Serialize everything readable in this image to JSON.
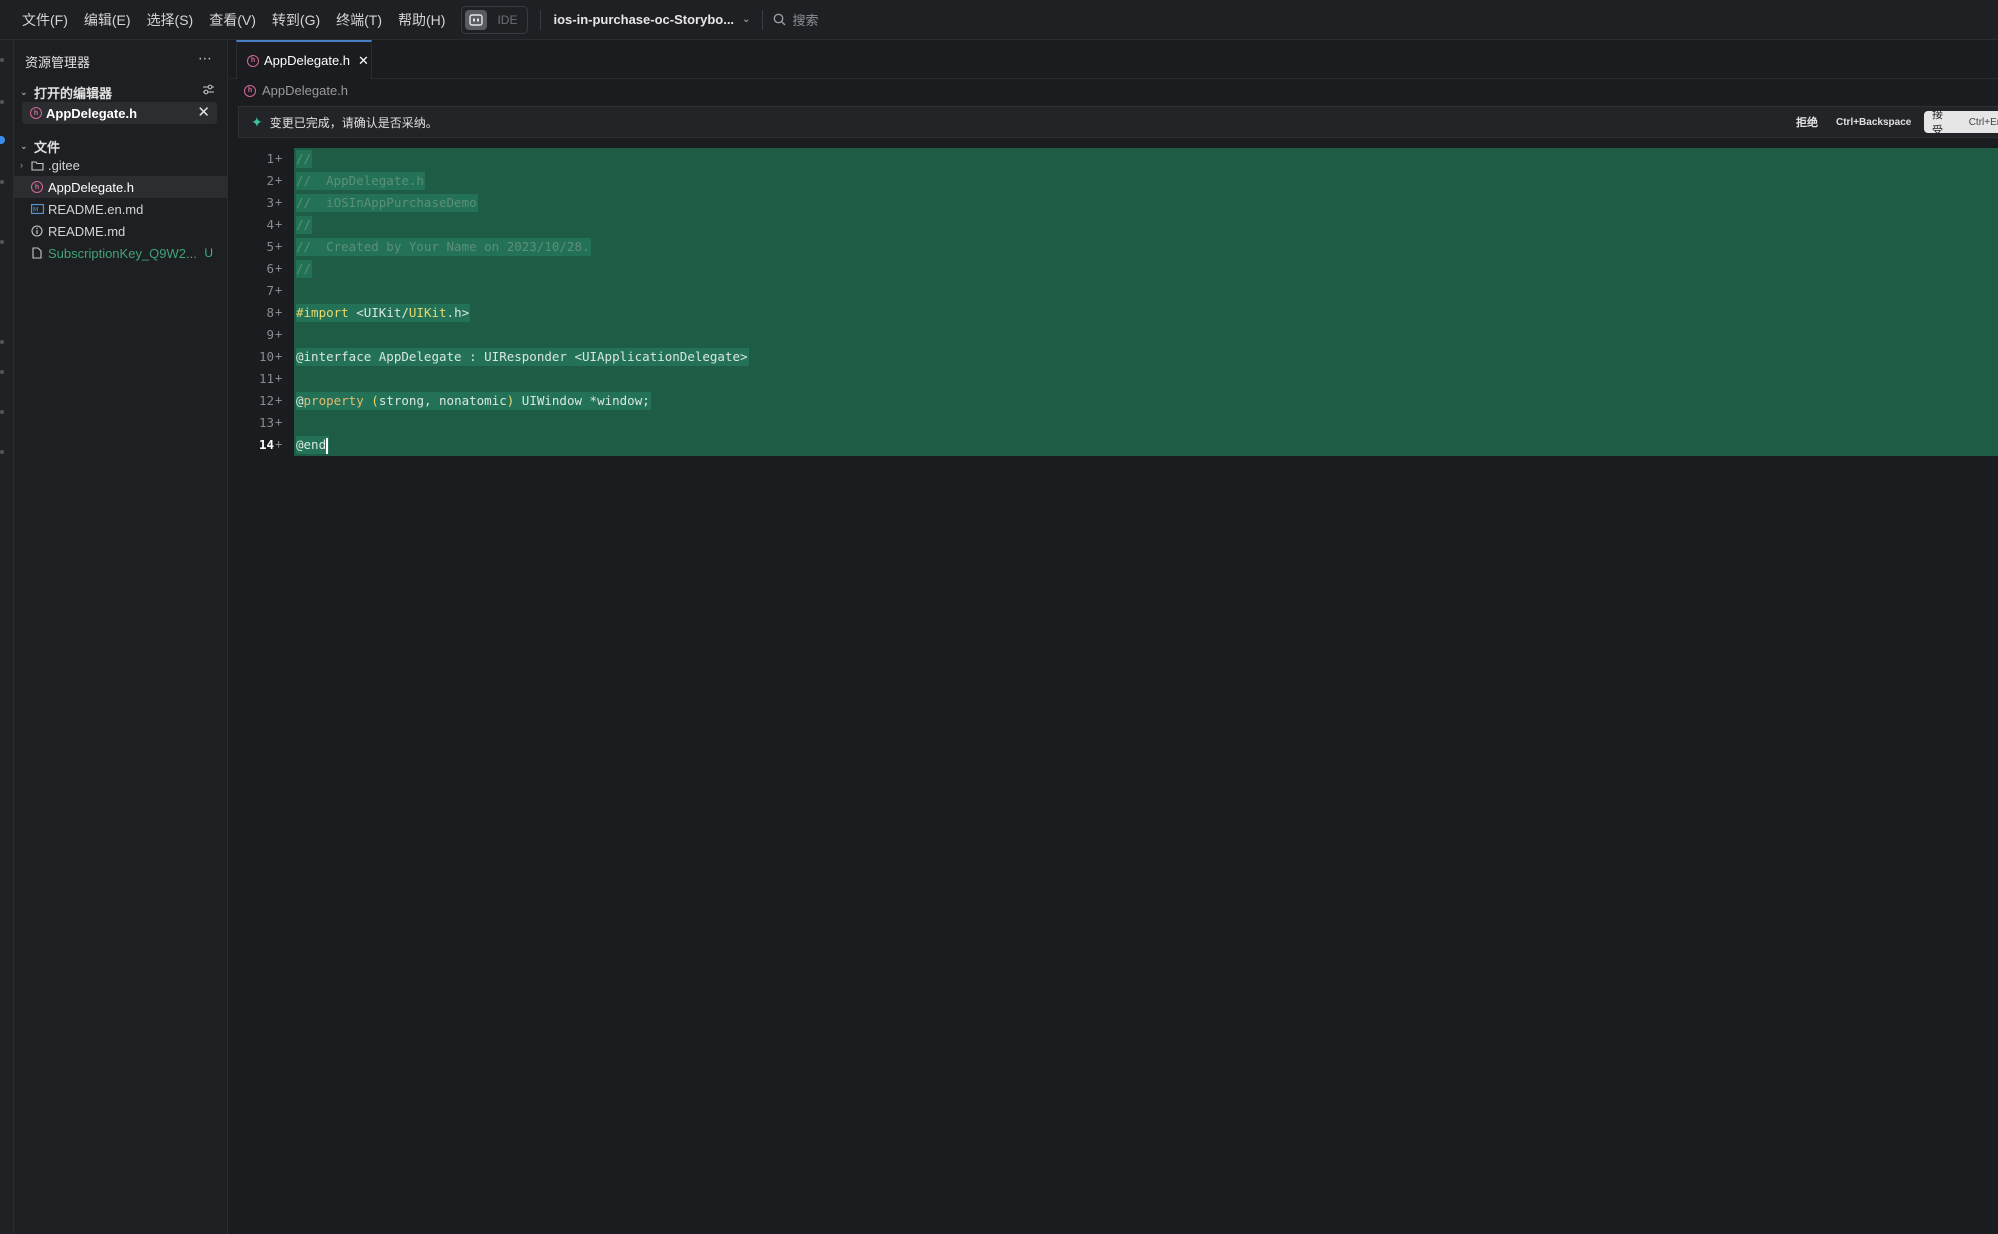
{
  "menu": [
    "文件(F)",
    "编辑(E)",
    "选择(S)",
    "查看(V)",
    "转到(G)",
    "终端(T)",
    "帮助(H)"
  ],
  "mode": {
    "ide_label": "IDE"
  },
  "project": {
    "name": "ios-in-purchase-oc-Storybo..."
  },
  "search": {
    "label": "搜索"
  },
  "sidebar": {
    "title": "资源管理器",
    "open_editors_title": "打开的编辑器",
    "open_file": "AppDelegate.h",
    "files_title": "文件",
    "files": [
      {
        "name": ".gitee",
        "type": "folder"
      },
      {
        "name": "AppDelegate.h",
        "type": "h-file"
      },
      {
        "name": "README.en.md",
        "type": "md-preview"
      },
      {
        "name": "README.md",
        "type": "info"
      },
      {
        "name": "SubscriptionKey_Q9W2...",
        "type": "file",
        "badge": "U"
      }
    ]
  },
  "editor": {
    "tab_label": "AppDelegate.h",
    "breadcrumb": "AppDelegate.h",
    "notification": {
      "message": "变更已完成，请确认是否采纳。",
      "reject_label": "拒绝",
      "reject_key": "Ctrl+Backspace",
      "accept_label": "接受",
      "accept_key": "Ctrl+Enter"
    },
    "current_line": 14,
    "lines": [
      "//",
      "//  AppDelegate.h",
      "//  iOSInAppPurchaseDemo",
      "//",
      "//  Created by Your Name on 2023/10/28.",
      "//",
      "",
      "#import <UIKit/UIKit.h>",
      "",
      "@interface AppDelegate : UIResponder <UIApplicationDelegate>",
      "",
      "@property (strong, nonatomic) UIWindow *window;",
      "",
      "@end"
    ]
  },
  "colors": {
    "added_line": "#1e5c45",
    "accent": "#4a7ec7",
    "untracked": "#3fa377"
  }
}
